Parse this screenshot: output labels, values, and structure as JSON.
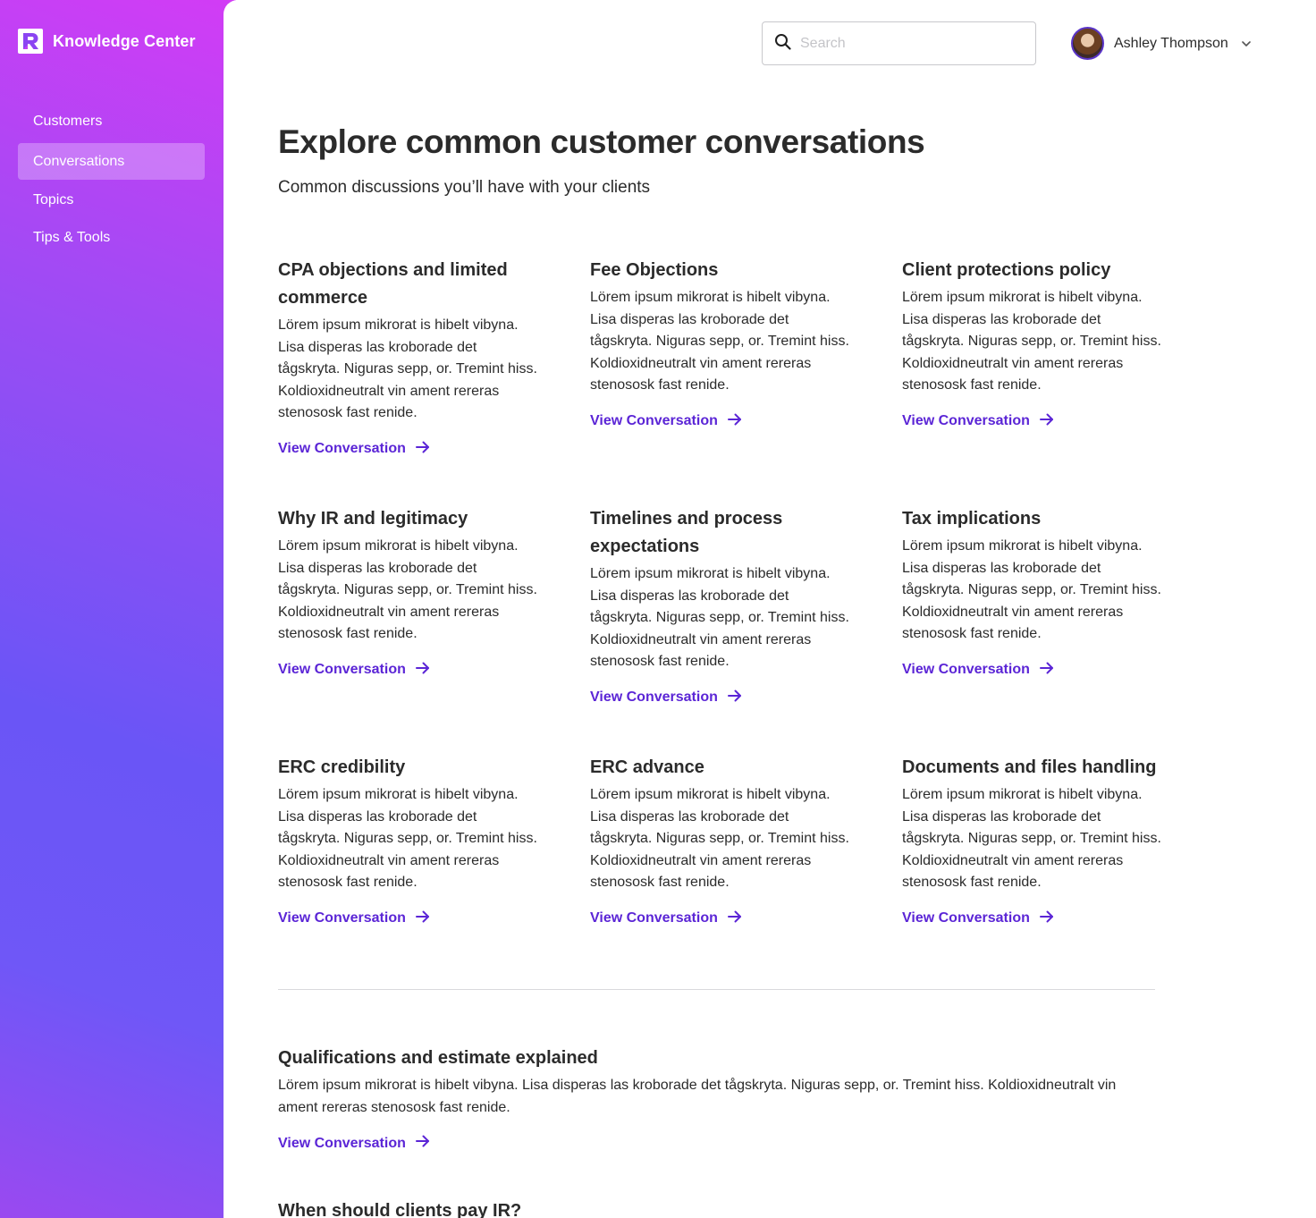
{
  "app": {
    "name": "Knowledge Center"
  },
  "sidebar": {
    "items": [
      {
        "label": "Customers"
      },
      {
        "label": "Conversations"
      },
      {
        "label": "Topics"
      },
      {
        "label": "Tips & Tools"
      }
    ],
    "active_item": "Conversations"
  },
  "header": {
    "search_placeholder": "Search",
    "search_value": "",
    "user_name": "Ashley Thompson"
  },
  "page": {
    "title": "Explore common customer conversations",
    "subtitle": "Common discussions you’ll have with your clients"
  },
  "cards": [
    {
      "title": "CPA objections and limited commerce",
      "body": "Lörem ipsum mikrorat is hibelt vibyna. Lisa disperas las kroborade det tågskryta. Niguras sepp, or. Tremint hiss. Koldioxidneutralt vin ament rereras stenososk fast renide.",
      "link": "View Conversation"
    },
    {
      "title": "Fee Objections",
      "body": "Lörem ipsum mikrorat is hibelt vibyna. Lisa disperas las kroborade det tågskryta. Niguras sepp, or. Tremint hiss. Koldioxidneutralt vin ament rereras stenososk fast renide.",
      "link": "View Conversation"
    },
    {
      "title": "Client protections policy",
      "body": "Lörem ipsum mikrorat is hibelt vibyna. Lisa disperas las kroborade det tågskryta. Niguras sepp, or. Tremint hiss. Koldioxidneutralt vin ament rereras stenososk fast renide.",
      "link": "View Conversation"
    },
    {
      "title": "Why IR and legitimacy",
      "body": "Lörem ipsum mikrorat is hibelt vibyna. Lisa disperas las kroborade det tågskryta. Niguras sepp, or. Tremint hiss. Koldioxidneutralt vin ament rereras stenososk fast renide.",
      "link": "View Conversation"
    },
    {
      "title": "Timelines and process expectations",
      "body": "Lörem ipsum mikrorat is hibelt vibyna. Lisa disperas las kroborade det tågskryta. Niguras sepp, or. Tremint hiss. Koldioxidneutralt vin ament rereras stenososk fast renide.",
      "link": "View Conversation"
    },
    {
      "title": "Tax implications",
      "body": "Lörem ipsum mikrorat is hibelt vibyna. Lisa disperas las kroborade det tågskryta. Niguras sepp, or. Tremint hiss. Koldioxidneutralt vin ament rereras stenososk fast renide.",
      "link": "View Conversation"
    },
    {
      "title": "ERC credibility",
      "body": "Lörem ipsum mikrorat is hibelt vibyna. Lisa disperas las kroborade det tågskryta. Niguras sepp, or. Tremint hiss. Koldioxidneutralt vin ament rereras stenososk fast renide.",
      "link": "View Conversation"
    },
    {
      "title": "ERC advance",
      "body": "Lörem ipsum mikrorat is hibelt vibyna. Lisa disperas las kroborade det tågskryta. Niguras sepp, or. Tremint hiss. Koldioxidneutralt vin ament rereras stenososk fast renide.",
      "link": "View Conversation"
    },
    {
      "title": "Documents and files handling",
      "body": "Lörem ipsum mikrorat is hibelt vibyna. Lisa disperas las kroborade det tågskryta. Niguras sepp, or. Tremint hiss. Koldioxidneutralt vin ament rereras stenososk fast renide.",
      "link": "View Conversation"
    }
  ],
  "wide_cards": [
    {
      "title": "Qualifications and estimate explained",
      "body": "Lörem ipsum mikrorat is hibelt vibyna. Lisa disperas las kroborade det tågskryta. Niguras sepp, or. Tremint hiss. Koldioxidneutralt vin ament rereras stenososk fast renide.",
      "link": "View Conversation"
    },
    {
      "title": "When should clients pay IR?"
    }
  ],
  "colors": {
    "accent": "#5b25d6",
    "sidebar_gradient_top": "#d23cf5",
    "sidebar_gradient_mid": "#6a55f6",
    "text": "#2b2b2b"
  },
  "icons": {
    "logo": "logo-r-icon",
    "search": "search-icon",
    "chevron": "chevron-down-icon",
    "link_arrow": "arrow-right-icon"
  }
}
